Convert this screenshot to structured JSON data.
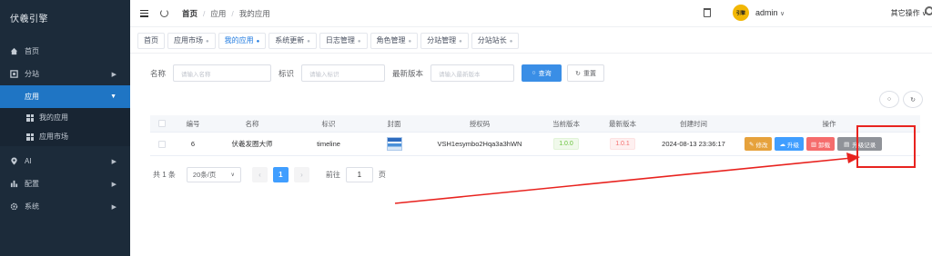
{
  "sidebar": {
    "brand": "伏羲引擎",
    "items": [
      {
        "label": "首页",
        "icon": "home-icon"
      },
      {
        "label": "分站",
        "icon": "building-icon"
      },
      {
        "label": "应用",
        "icon": "apps-icon"
      },
      {
        "label": "AI",
        "icon": "location-icon"
      },
      {
        "label": "配置",
        "icon": "bar-chart-icon"
      },
      {
        "label": "系统",
        "icon": "gear-icon"
      }
    ],
    "sub_items": [
      {
        "label": "我的应用"
      },
      {
        "label": "应用市场"
      }
    ]
  },
  "header": {
    "breadcrumb": [
      "首页",
      "应用",
      "我的应用"
    ],
    "username": "admin",
    "avatar_text": "引擎"
  },
  "tabs": {
    "items": [
      "首页",
      "应用市场",
      "我的应用",
      "系统更新",
      "日志管理",
      "角色管理",
      "分站管理",
      "分站站长"
    ],
    "active": "我的应用",
    "other_ops": "其它操作"
  },
  "search": {
    "name_label": "名称",
    "name_placeholder": "请输入名称",
    "ident_label": "标识",
    "ident_placeholder": "请输入标识",
    "latest_label": "最新版本",
    "latest_placeholder": "请输入最新版本",
    "query_button": "查询",
    "reset_button": "重置"
  },
  "table": {
    "columns": [
      "编号",
      "名称",
      "标识",
      "封面",
      "授权码",
      "当前版本",
      "最新版本",
      "创建时间",
      "操作"
    ],
    "rows": [
      {
        "id": "6",
        "name": "伏羲发圈大师",
        "ident": "timeline",
        "auth_code": "VSH1esymbo2Hqa3a3hWN",
        "current_version": "1.0.0",
        "latest_version": "1.0.1",
        "created_at": "2024-08-13 23:36:17",
        "ops": [
          "修改",
          "升级",
          "卸载",
          "升级记录"
        ]
      }
    ]
  },
  "pagination": {
    "total": "共 1 条",
    "page_size": "20条/页",
    "current_page": "1",
    "goto_label": "前往",
    "goto_value": "1",
    "page_unit": "页"
  },
  "colors": {
    "sidebar_bg": "#1c2b3a",
    "active_menu": "#1f75c4",
    "primary": "#409eff",
    "annotation": "#e8231f"
  }
}
